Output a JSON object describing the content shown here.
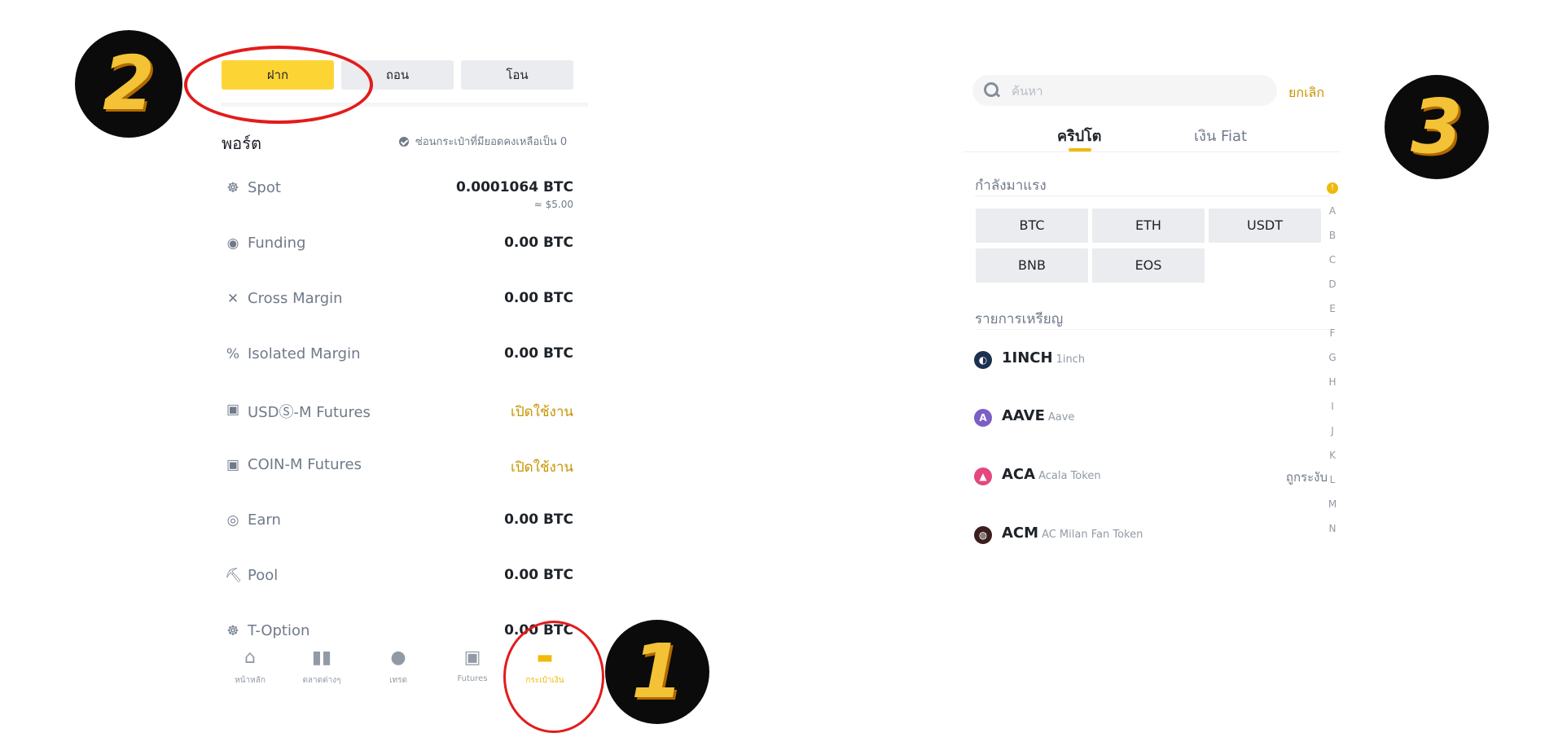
{
  "wallet": {
    "tabs": [
      {
        "label": "ฝาก"
      },
      {
        "label": "ถอน"
      },
      {
        "label": "โอน"
      }
    ],
    "portfolio_title": "พอร์ต",
    "hide_zero_label": "ซ่อนกระเป๋าที่มียอดคงเหลือเป็น 0",
    "accounts": [
      {
        "name": "Spot",
        "value": "0.0001064 BTC",
        "sub": "≈ $5.00",
        "icon": "spot-icon"
      },
      {
        "name": "Funding",
        "value": "0.00 BTC",
        "icon": "funding-icon"
      },
      {
        "name": "Cross Margin",
        "value": "0.00 BTC",
        "icon": "cross-margin-icon"
      },
      {
        "name": "Isolated Margin",
        "value": "0.00 BTC",
        "icon": "isolated-margin-icon"
      },
      {
        "name": "USDⓈ-M Futures",
        "value": "เปิดใช้งาน",
        "icon": "usdm-futures-icon"
      },
      {
        "name": "COIN-M Futures",
        "value": "เปิดใช้งาน",
        "icon": "coinm-futures-icon"
      },
      {
        "name": "Earn",
        "value": "0.00 BTC",
        "icon": "earn-icon"
      },
      {
        "name": "Pool",
        "value": "0.00 BTC",
        "icon": "pool-icon"
      },
      {
        "name": "T-Option",
        "value": "0.00 BTC",
        "icon": "t-option-icon"
      }
    ],
    "bottom_nav": [
      {
        "label": "หน้าหลัก",
        "icon": "home-icon"
      },
      {
        "label": "ตลาดต่างๆ",
        "icon": "markets-icon"
      },
      {
        "label": "เทรด",
        "icon": "trade-icon"
      },
      {
        "label": "Futures",
        "icon": "futures-icon"
      },
      {
        "label": "กระเป๋าเงิน",
        "icon": "wallet-icon",
        "active": true
      }
    ]
  },
  "annotations": {
    "step_1": "1",
    "step_2": "2",
    "step_3": "3"
  },
  "deposit": {
    "search_placeholder": "ค้นหา",
    "cancel_label": "ยกเลิก",
    "tabs": [
      {
        "label": "คริปโต"
      },
      {
        "label": "เงิน Fiat"
      }
    ],
    "trending_title": "กำลังมาแรง",
    "trending": [
      "BTC",
      "ETH",
      "USDT",
      "BNB",
      "EOS"
    ],
    "list_title": "รายการเหรียญ",
    "coins": [
      {
        "symbol": "1INCH",
        "name": "1inch",
        "icon": "1inch-logo-icon",
        "color": "#1b314f"
      },
      {
        "symbol": "AAVE",
        "name": "Aave",
        "icon": "aave-logo-icon",
        "color": "#7b5fc6"
      },
      {
        "symbol": "ACA",
        "name": "Acala Token",
        "icon": "aca-logo-icon",
        "color": "#e4477f",
        "note": "ถูกระงับ"
      },
      {
        "symbol": "ACM",
        "name": "AC Milan Fan Token",
        "icon": "acm-logo-icon",
        "color": "#3b1e1e"
      }
    ],
    "index_hot": "!",
    "index_letters": [
      "A",
      "B",
      "C",
      "D",
      "E",
      "F",
      "G",
      "H",
      "I",
      "J",
      "K",
      "L",
      "M",
      "N"
    ]
  },
  "colors": {
    "accent": "#fcd535",
    "accent_text": "#c99400",
    "annotation_red": "#e31b1b",
    "badge_gold": "#f3c236"
  }
}
